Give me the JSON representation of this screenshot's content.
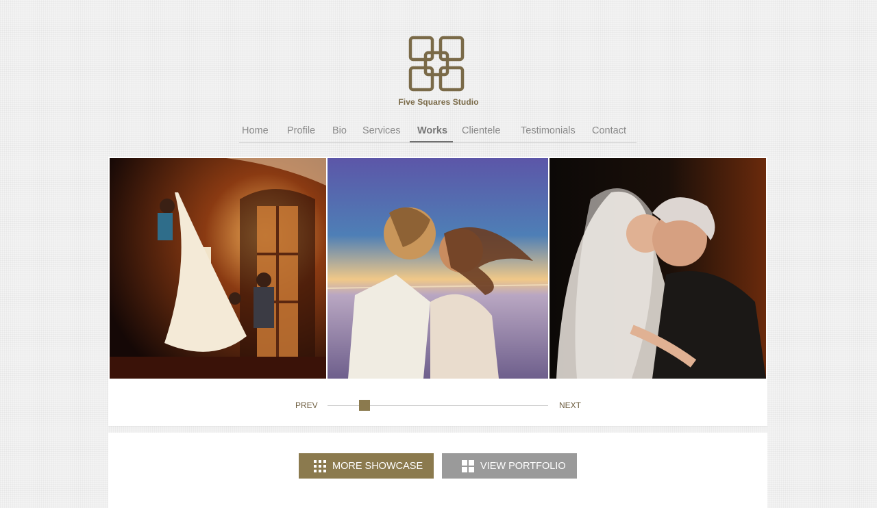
{
  "brand": {
    "name": "Five Squares Studio",
    "color": "#7a6a48"
  },
  "nav": {
    "items": [
      {
        "label": "Home"
      },
      {
        "label": "Profile"
      },
      {
        "label": "Bio"
      },
      {
        "label": "Services"
      },
      {
        "label": "Works"
      },
      {
        "label": "Clientele"
      },
      {
        "label": "Testimonials"
      },
      {
        "label": "Contact"
      }
    ],
    "active": "Works"
  },
  "gallery": {
    "photos": [
      {
        "subject": "bride-dress-preparation-photo"
      },
      {
        "subject": "couple-kissing-sunset-photo"
      },
      {
        "subject": "bride-embracing-grandmother-photo"
      }
    ],
    "prev_label": "PREV",
    "next_label": "NEXT",
    "slider_position": 0.15
  },
  "actions": {
    "more_showcase_label": "MORE SHOWCASE",
    "view_portfolio_label": "VIEW PORTFOLIO"
  },
  "colors": {
    "accent": "#8b7a4e",
    "secondary_button": "#9a9a9a"
  }
}
